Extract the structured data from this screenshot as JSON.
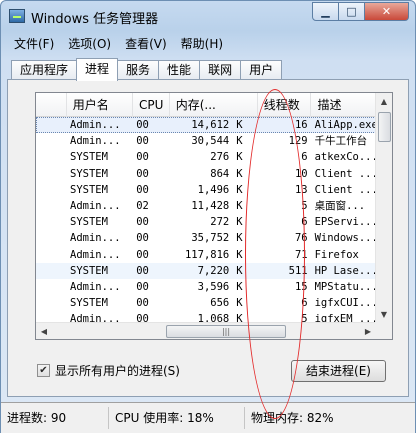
{
  "window": {
    "title": "Windows 任务管理器"
  },
  "menu": [
    "文件(F)",
    "选项(O)",
    "查看(V)",
    "帮助(H)"
  ],
  "tabs": [
    "应用程序",
    "进程",
    "服务",
    "性能",
    "联网",
    "用户"
  ],
  "active_tab": "进程",
  "columns": [
    "用户名",
    "CPU",
    "内存(...",
    "线程数",
    "描述"
  ],
  "rows": [
    {
      "user": "Admin...",
      "cpu": "00",
      "mem": "14,612",
      "unit": "K",
      "threads": "16",
      "desc": "AliApp.exe"
    },
    {
      "user": "Admin...",
      "cpu": "00",
      "mem": "30,544",
      "unit": "K",
      "threads": "129",
      "desc": "千牛工作台"
    },
    {
      "user": "SYSTEM",
      "cpu": "00",
      "mem": "276",
      "unit": "K",
      "threads": "6",
      "desc": "atkexCo..."
    },
    {
      "user": "SYSTEM",
      "cpu": "00",
      "mem": "864",
      "unit": "K",
      "threads": "10",
      "desc": "Client ..."
    },
    {
      "user": "SYSTEM",
      "cpu": "00",
      "mem": "1,496",
      "unit": "K",
      "threads": "13",
      "desc": "Client ..."
    },
    {
      "user": "Admin...",
      "cpu": "02",
      "mem": "11,428",
      "unit": "K",
      "threads": "5",
      "desc": "桌面窗..."
    },
    {
      "user": "SYSTEM",
      "cpu": "00",
      "mem": "272",
      "unit": "K",
      "threads": "6",
      "desc": "EPServi..."
    },
    {
      "user": "Admin...",
      "cpu": "00",
      "mem": "35,752",
      "unit": "K",
      "threads": "76",
      "desc": "Windows..."
    },
    {
      "user": "Admin...",
      "cpu": "00",
      "mem": "117,816",
      "unit": "K",
      "threads": "71",
      "desc": "Firefox"
    },
    {
      "user": "SYSTEM",
      "cpu": "00",
      "mem": "7,220",
      "unit": "K",
      "threads": "511",
      "desc": "HP Lase..."
    },
    {
      "user": "Admin...",
      "cpu": "00",
      "mem": "3,596",
      "unit": "K",
      "threads": "15",
      "desc": "MPStatu..."
    },
    {
      "user": "SYSTEM",
      "cpu": "00",
      "mem": "656",
      "unit": "K",
      "threads": "6",
      "desc": "igfxCUI..."
    },
    {
      "user": "Admin...",
      "cpu": "00",
      "mem": "1,068",
      "unit": "K",
      "threads": "5",
      "desc": "igfxEM ..."
    }
  ],
  "show_all_users": {
    "label": "显示所有用户的进程(S)",
    "checked": true
  },
  "end_process_label": "结束进程(E)",
  "status": {
    "processes": "进程数: 90",
    "cpu": "CPU 使用率: 18%",
    "memory": "物理内存: 82%"
  },
  "colors": {
    "annotation": "#e32b2b",
    "selection": "#e8f0fc"
  }
}
